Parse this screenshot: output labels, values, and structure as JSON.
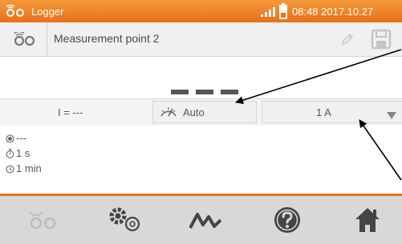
{
  "status_bar": {
    "title": "Logger",
    "datetime": "08:48 2017.10.27",
    "icons": [
      "logger-icon",
      "signal-icon",
      "battery-icon"
    ],
    "color": "#e8701a"
  },
  "point_bar": {
    "name": "Measurement point 2",
    "icons": [
      "logger-icon",
      "edit-icon",
      "save-icon"
    ]
  },
  "reading": {
    "value": "---"
  },
  "settings": {
    "current_label": "I = ---",
    "mode_label": "Auto",
    "mode_icon": "auto-range-icon",
    "range_value": "1 A",
    "range_icon": "dropdown-arrow-icon"
  },
  "params": {
    "mode": "---",
    "interval": "1 s",
    "duration": "1 min",
    "icons": [
      "mode-dot-icon",
      "stopwatch-icon",
      "clock-icon"
    ]
  },
  "nav": {
    "items": [
      "logger-icon",
      "settings-icon",
      "waveform-icon",
      "help-icon",
      "home-icon"
    ],
    "accent": "#e8701a"
  }
}
